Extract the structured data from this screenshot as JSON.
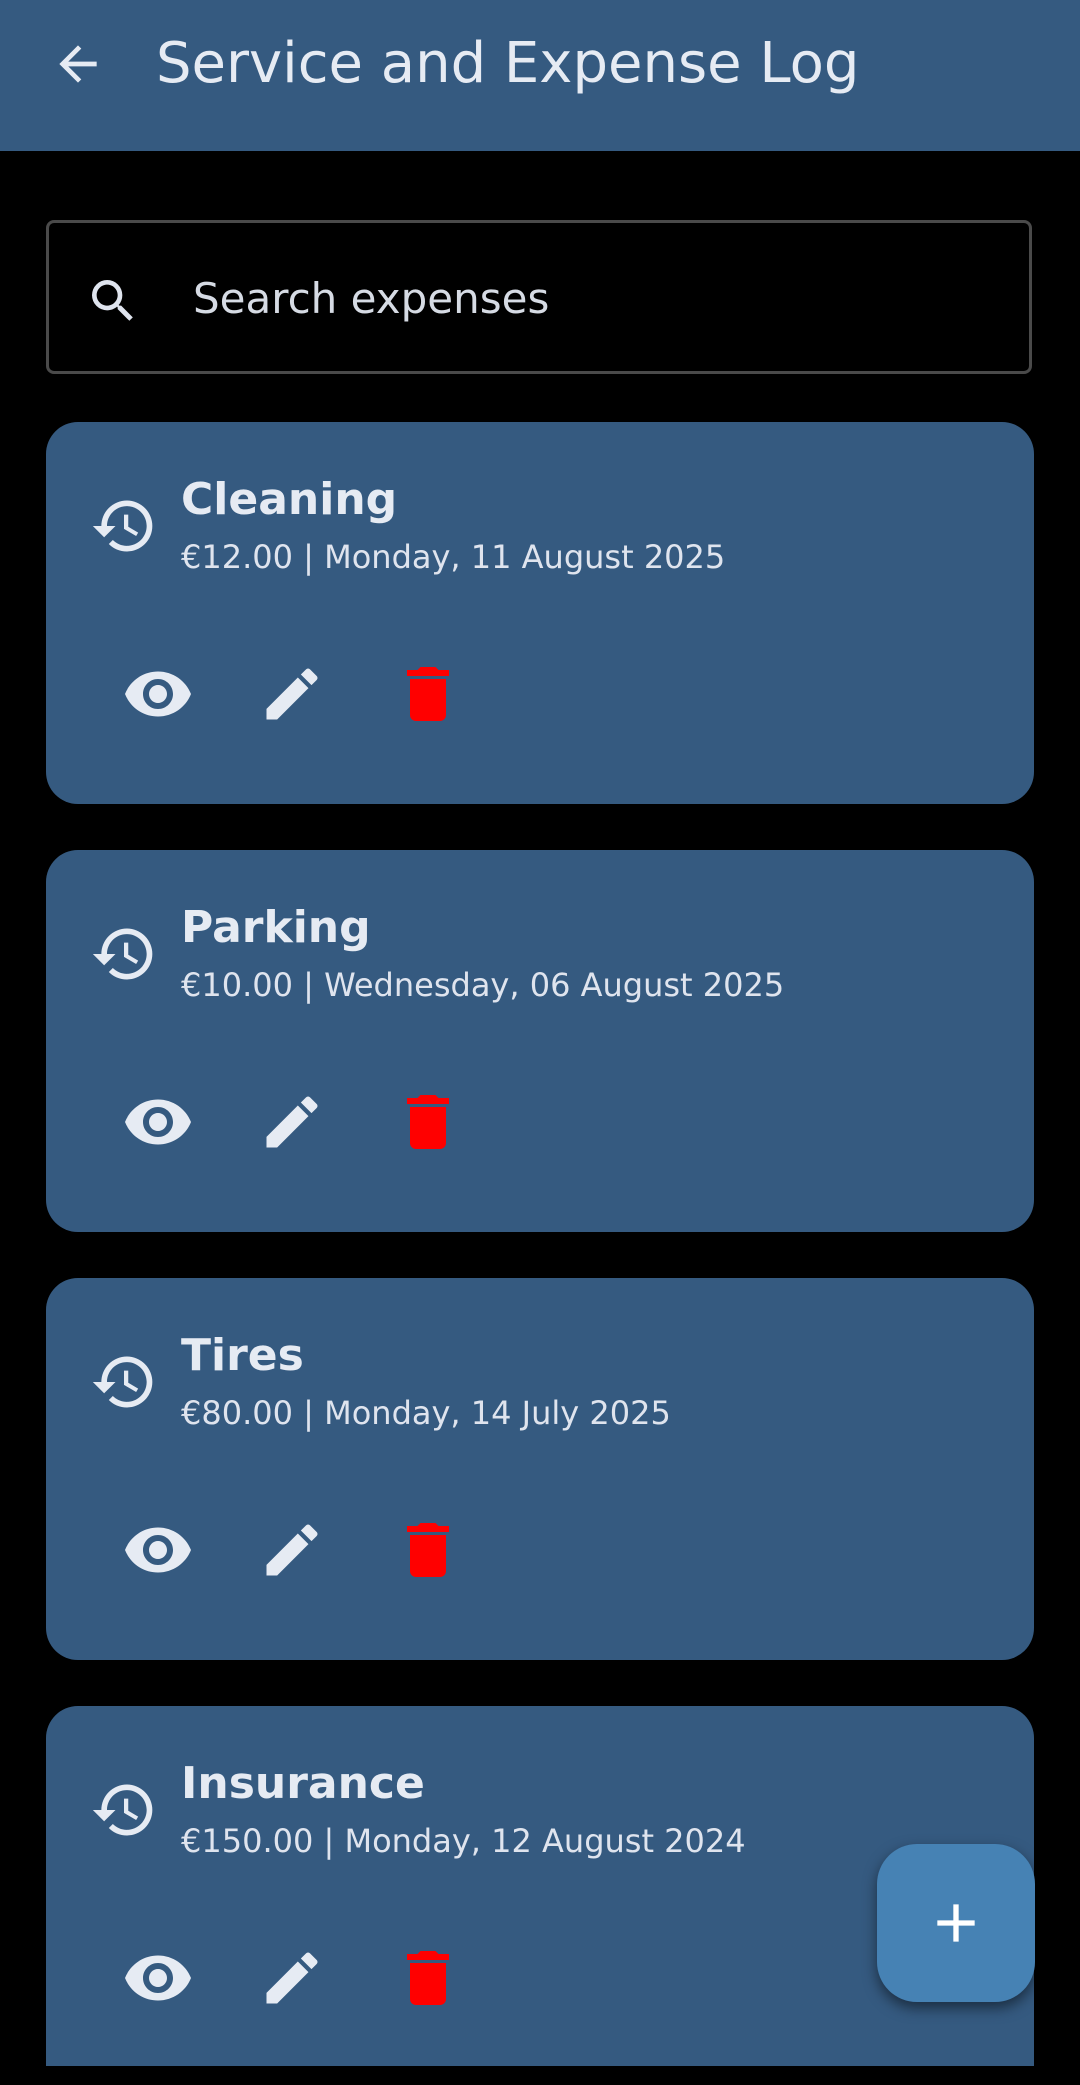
{
  "app_bar": {
    "title": "Service and Expense Log",
    "back_icon": "arrow-back-icon"
  },
  "search": {
    "placeholder": "Search expenses",
    "value": "",
    "icon": "search-icon"
  },
  "colors": {
    "app_bar": "#355a80",
    "card": "#355a80",
    "background": "#000000",
    "delete_icon": "#ff0000",
    "fab": "#4682b4"
  },
  "expenses": [
    {
      "title": "Cleaning",
      "subtitle": "€12.00 | Monday, 11 August 2025"
    },
    {
      "title": "Parking",
      "subtitle": "€10.00 | Wednesday, 06 August 2025"
    },
    {
      "title": "Tires",
      "subtitle": "€80.00 | Monday, 14 July 2025"
    },
    {
      "title": "Insurance",
      "subtitle": "€150.00 | Monday, 12 August 2024"
    }
  ],
  "card_actions": {
    "view_icon": "eye-icon",
    "edit_icon": "pencil-icon",
    "delete_icon": "trash-icon",
    "card_icon": "history-icon"
  },
  "fab": {
    "icon": "plus-icon"
  }
}
